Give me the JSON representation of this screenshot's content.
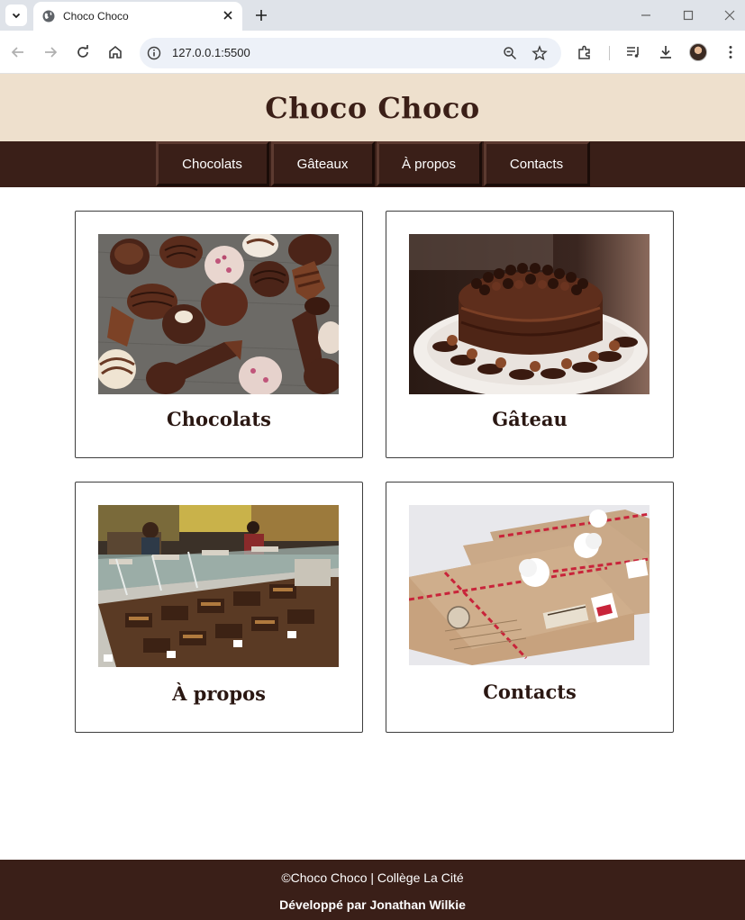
{
  "browser": {
    "tab_title": "Choco Choco",
    "url": "127.0.0.1:5500"
  },
  "site": {
    "title": "Choco Choco",
    "nav": [
      "Chocolats",
      "Gâteaux",
      "À propos",
      "Contacts"
    ],
    "cards": [
      {
        "title": "Chocolats",
        "image": "assorted chocolates photo"
      },
      {
        "title": "Gâteau",
        "image": "chocolate cake photo"
      },
      {
        "title": "À propos",
        "image": "chocolate shop counter photo"
      },
      {
        "title": "Contacts",
        "image": "envelopes with twine photo"
      }
    ],
    "footer": {
      "copyright": "©Choco Choco | Collège La Cité",
      "credit": "Développé par Jonathan Wilkie"
    }
  },
  "colors": {
    "header_bg": "#eee0cd",
    "nav_bg": "#3a1f18",
    "title_text": "#3b1f17"
  }
}
